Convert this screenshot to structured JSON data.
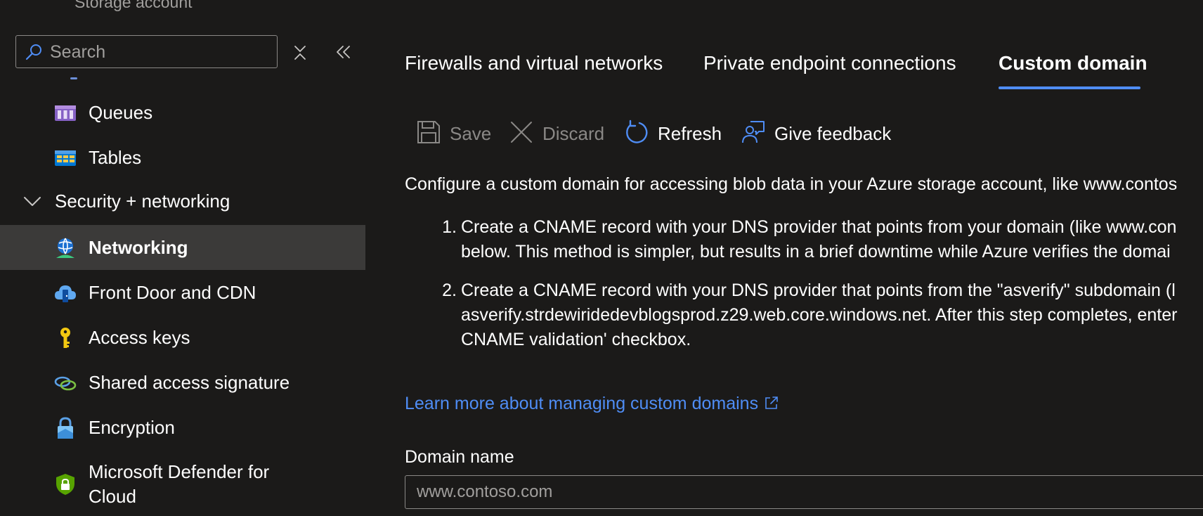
{
  "sidebar": {
    "resource_subtitle": "Storage account",
    "search": {
      "placeholder": "Search",
      "value": ""
    },
    "items_top": [
      {
        "label": "Queues",
        "icon": "queues-icon"
      },
      {
        "label": "Tables",
        "icon": "tables-icon"
      }
    ],
    "group": {
      "label": "Security + networking",
      "expanded": true
    },
    "items": [
      {
        "label": "Networking",
        "icon": "networking-icon",
        "selected": true
      },
      {
        "label": "Front Door and CDN",
        "icon": "front-door-icon"
      },
      {
        "label": "Access keys",
        "icon": "key-icon"
      },
      {
        "label": "Shared access signature",
        "icon": "link-icon"
      },
      {
        "label": "Encryption",
        "icon": "lock-icon"
      },
      {
        "label": "Microsoft Defender for Cloud",
        "icon": "defender-shield-icon"
      }
    ]
  },
  "tabs": [
    {
      "label": "Firewalls and virtual networks",
      "active": false
    },
    {
      "label": "Private endpoint connections",
      "active": false
    },
    {
      "label": "Custom domain",
      "active": true
    }
  ],
  "toolbar": {
    "save": {
      "label": "Save",
      "enabled": false
    },
    "discard": {
      "label": "Discard",
      "enabled": false
    },
    "refresh": {
      "label": "Refresh",
      "enabled": true
    },
    "feedback": {
      "label": "Give feedback",
      "enabled": true
    }
  },
  "content": {
    "intro": "Configure a custom domain for accessing blob data in your Azure storage account, like www.contos",
    "steps": [
      {
        "number": "1.",
        "text": "Create a CNAME record with your DNS provider that points from your domain (like www.con\nbelow. This method is simpler, but results in a brief downtime while Azure verifies the domai"
      },
      {
        "number": "2.",
        "text": "Create a CNAME record with your DNS provider that points from the \"asverify\" subdomain (l\nasverify.strdewiridedevblogsprod.z29.web.core.windows.net. After this step completes, enter\nCNAME validation' checkbox."
      }
    ],
    "learn_more": "Learn more about managing custom domains",
    "domain_field": {
      "label": "Domain name",
      "placeholder": "www.contoso.com",
      "value": ""
    }
  },
  "colors": {
    "accent": "#4f8df5",
    "background": "#1b1a19",
    "selected_row": "#3b3a39",
    "disabled_text": "#8a8886"
  }
}
